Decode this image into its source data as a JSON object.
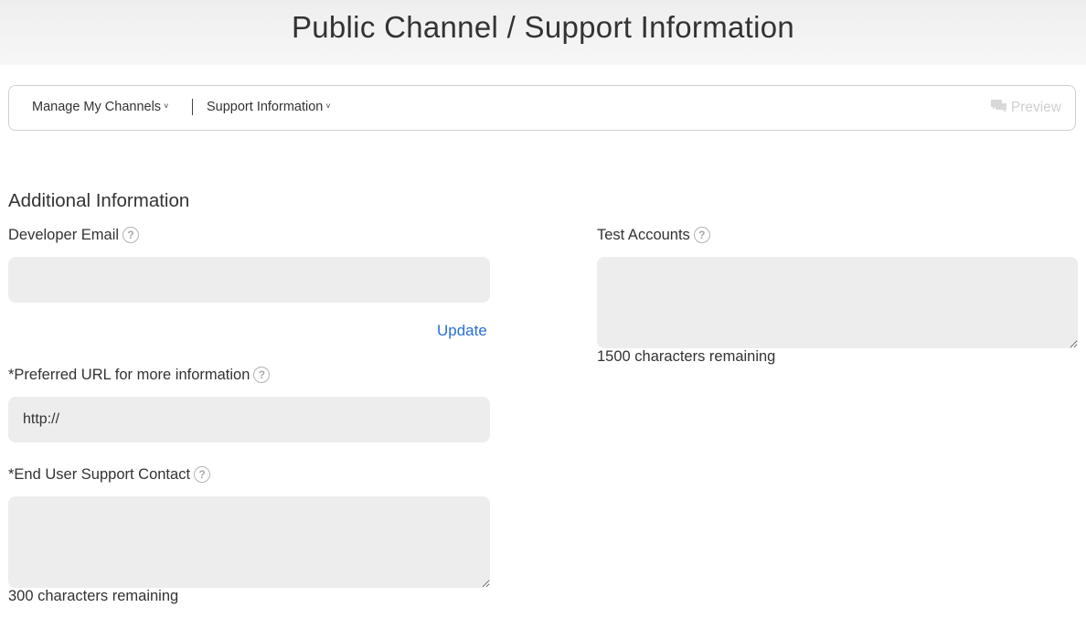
{
  "header": {
    "title": "Public Channel / Support Information"
  },
  "nav": {
    "manage_channels": "Manage My Channels",
    "support_information": "Support Information",
    "chevron": "˅",
    "preview": "Preview",
    "preview_icon": "chat-bubble-icon"
  },
  "section": {
    "title": "Additional Information"
  },
  "developer_email": {
    "label": "Developer Email",
    "value": "",
    "update_label": "Update"
  },
  "preferred_url": {
    "label": "*Preferred URL for more information",
    "value": "http://"
  },
  "support_contact": {
    "label": "*End User Support Contact",
    "value": "",
    "remaining": "300 characters remaining"
  },
  "test_accounts": {
    "label": "Test Accounts",
    "value": "",
    "remaining": "1500 characters remaining"
  },
  "help_glyph": "?",
  "colors": {
    "link": "#2a6fd6",
    "input_bg": "#ededed",
    "border": "#cfcfcf"
  }
}
